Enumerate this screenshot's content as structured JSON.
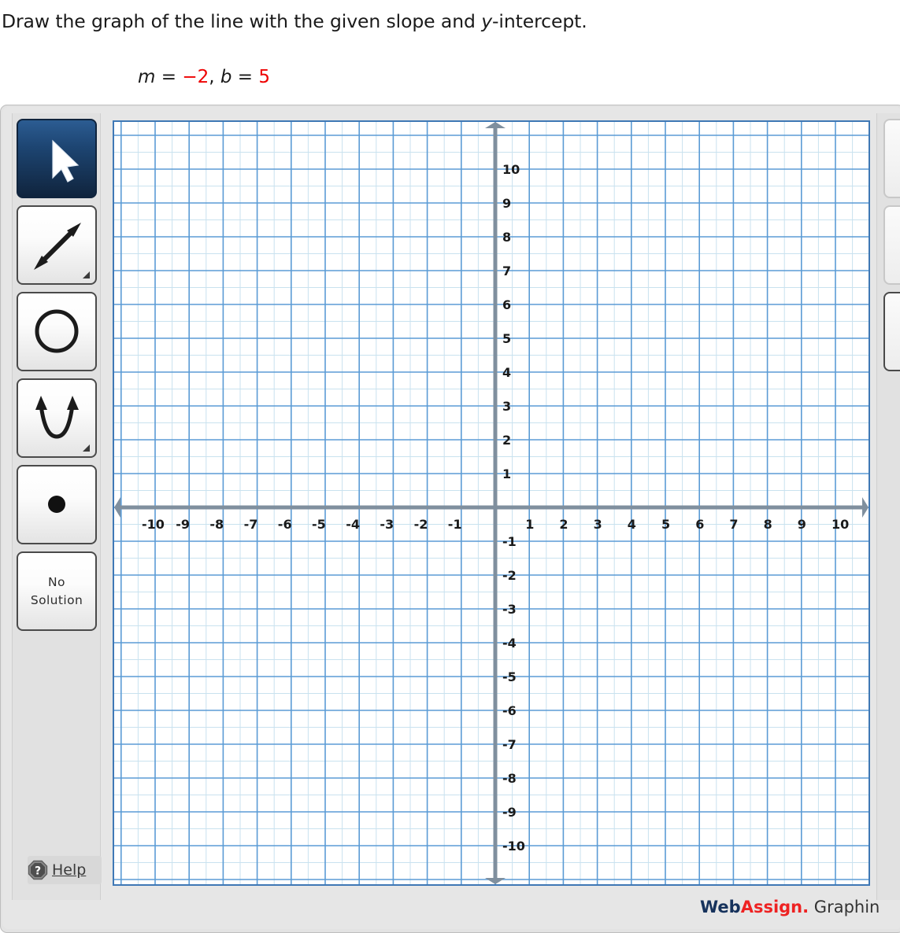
{
  "question": {
    "prompt_pre": "Draw the graph of the line with the given slope and ",
    "prompt_var": "y",
    "prompt_post": "-intercept.",
    "equation": {
      "m_label": "m",
      "eq1": " = ",
      "m_value": "−2",
      "comma": ", ",
      "b_label": "b",
      "eq2": " = ",
      "b_value": "5",
      "value_color": "#ee0000"
    }
  },
  "toolbar": {
    "tools": [
      {
        "id": "select",
        "name": "pointer-tool",
        "label": "Select",
        "selected": true,
        "has_submenu": false
      },
      {
        "id": "line",
        "name": "line-tool",
        "label": "Line",
        "selected": false,
        "has_submenu": true
      },
      {
        "id": "circle",
        "name": "circle-tool",
        "label": "Circle",
        "selected": false,
        "has_submenu": false
      },
      {
        "id": "parabola",
        "name": "parabola-tool",
        "label": "Parabola",
        "selected": false,
        "has_submenu": true
      },
      {
        "id": "point",
        "name": "point-tool",
        "label": "Point",
        "selected": false,
        "has_submenu": false
      },
      {
        "id": "nosolution",
        "name": "no-solution-tool",
        "label": "No Solution",
        "label_line1": "No",
        "label_line2": "Solution",
        "selected": false,
        "has_submenu": false
      }
    ],
    "help": {
      "label": "Help",
      "icon": "question-mark-icon"
    }
  },
  "right_toolbar": {
    "buttons": [
      {
        "name": "right-tool-1",
        "label": ""
      },
      {
        "name": "right-tool-2",
        "label": ""
      },
      {
        "name": "right-tool-3",
        "label": ""
      }
    ]
  },
  "footer": {
    "brand_web": "Web",
    "brand_assign": "Assign.",
    "product": " Graphin"
  },
  "chart_data": {
    "type": "scatter",
    "title": "",
    "xlabel": "",
    "ylabel": "",
    "xlim": [
      -11,
      11
    ],
    "ylim": [
      -11,
      11
    ],
    "grid": true,
    "minor_grid": true,
    "minor_subdivisions": 2,
    "legend": "none",
    "x_ticks": [
      -10,
      -9,
      -8,
      -7,
      -6,
      -5,
      -4,
      -3,
      -2,
      -1,
      1,
      2,
      3,
      4,
      5,
      6,
      7,
      8,
      9,
      10
    ],
    "y_ticks": [
      10,
      9,
      8,
      7,
      6,
      5,
      4,
      3,
      2,
      1,
      -1,
      -2,
      -3,
      -4,
      -5,
      -6,
      -7,
      -8,
      -9,
      -10
    ],
    "x_tick_labels": [
      "-10",
      "-9",
      "-8",
      "-7",
      "-6",
      "-5",
      "-4",
      "-3",
      "-2",
      "-1",
      "1",
      "2",
      "3",
      "4",
      "5",
      "6",
      "7",
      "8",
      "9",
      "10"
    ],
    "y_tick_labels": [
      "10",
      "9",
      "8",
      "7",
      "6",
      "5",
      "4",
      "3",
      "2",
      "1",
      "-1",
      "-2",
      "-3",
      "-4",
      "-5",
      "-6",
      "-7",
      "-8",
      "-9",
      "-10"
    ],
    "axis_color": "#7f8f9e",
    "major_grid_color": "#5b9bd5",
    "minor_grid_color": "#c7e1ef",
    "series": [],
    "values": [],
    "categories": [],
    "annotations": [],
    "axis_arrows": [
      "left",
      "right",
      "up",
      "down"
    ]
  }
}
